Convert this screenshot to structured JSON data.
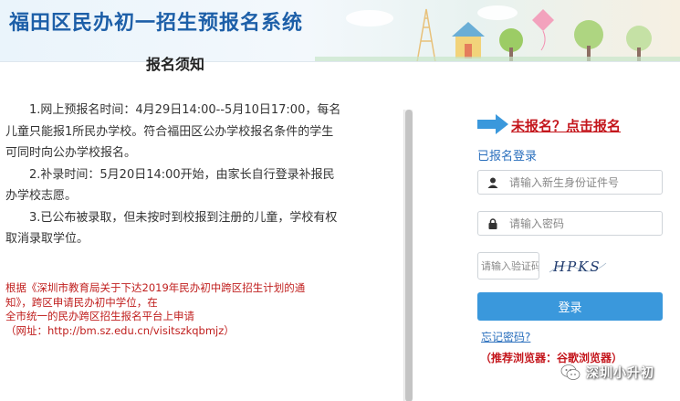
{
  "header": {
    "title": "福田区民办初一招生预报名系统"
  },
  "notice": {
    "title": "报名须知",
    "paragraphs": [
      "1.网上预报名时间：4月29日14:00--5月10日17:00，每名儿童只能报1所民办学校。符合福田区公办学校报名条件的学生可同时向公办学校报名。",
      "2.补录时间：5月20日14:00开始，由家长自行登录补报民办学校志愿。",
      "3.已公布被录取，但未按时到校报到注册的儿童，学校有权取消录取学位。"
    ],
    "red_note_lines": [
      "根据《深圳市教育局关于下达2019年民办初中跨区招生计划的通",
      "知》，跨区申请民办初中学位，在",
      "全市统一的民办跨区招生报名平台上申请",
      "（网址：http://bm.sz.edu.cn/visitszkqbmjz）"
    ]
  },
  "login": {
    "unregistered_link": "未报名？点击报名",
    "registered_label": "已报名登录",
    "id_placeholder": "请输入新生身份证件号",
    "password_placeholder": "请输入密码",
    "captcha_placeholder": "请输入验证码",
    "captcha_text": "HPKS",
    "login_button": "登录",
    "forgot_password": "忘记密码?",
    "browser_tip": "（推荐浏览器：谷歌浏览器）"
  },
  "watermark": {
    "text": "深圳小升初"
  },
  "colors": {
    "title_blue": "#1d5fa8",
    "link_red": "#c4161c",
    "button_blue": "#3a98dc",
    "link_blue": "#2a6fbd"
  }
}
